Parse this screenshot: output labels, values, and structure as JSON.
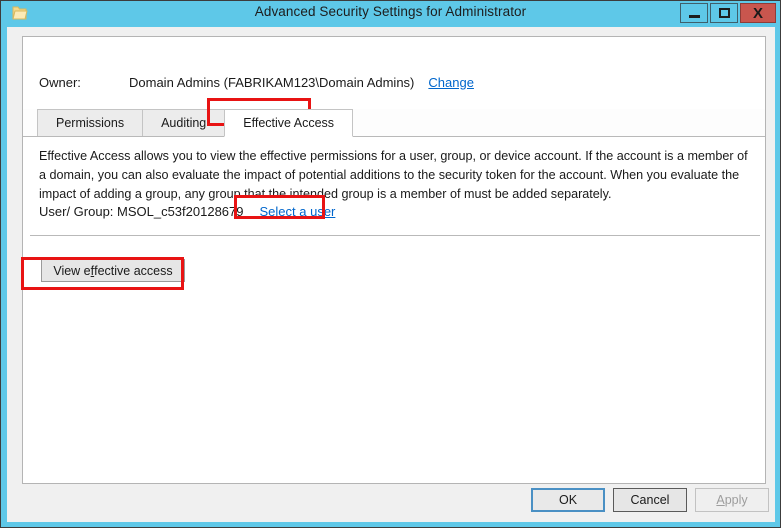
{
  "window": {
    "title": "Advanced Security Settings for Administrator",
    "icon": "folder-icon",
    "frame_color": "#5ec8e8",
    "caption": {
      "minimize_label": "Minimize",
      "maximize_label": "Maximize",
      "close_label": "Close",
      "close_glyph": "X",
      "close_color": "#c9564e"
    }
  },
  "owner": {
    "label": "Owner:",
    "value": "Domain Admins (FABRIKAM123\\Domain Admins)",
    "change_link": "Change",
    "link_color": "#0066cc"
  },
  "tabs": [
    {
      "label": "Permissions",
      "active": false
    },
    {
      "label": "Auditing",
      "active": false
    },
    {
      "label": "Effective Access",
      "active": true
    }
  ],
  "description": "Effective Access allows you to view the effective permissions for a user, group, or device account. If the account is a member of a domain, you can also evaluate the impact of potential additions to the security token for the account. When you evaluate the impact of adding a group, any group that the intended group is a member of must be added separately.",
  "user_group": {
    "label": "User/ Group:",
    "value": "MSOL_c53f20128679",
    "select_link_prefix": "Select a ",
    "select_link_accel": "u",
    "select_link_suffix": "ser"
  },
  "view_effective_access_button": {
    "prefix": "View e",
    "accel": "f",
    "suffix": "fective access"
  },
  "annotations": {
    "color": "#e81313",
    "targets": [
      "effective-access-tab",
      "select-a-user-link",
      "view-effective-access-button"
    ]
  },
  "footer": {
    "ok_label": "OK",
    "cancel_label": "Cancel",
    "apply_prefix": "",
    "apply_accel": "A",
    "apply_suffix": "pply",
    "apply_disabled": true
  }
}
